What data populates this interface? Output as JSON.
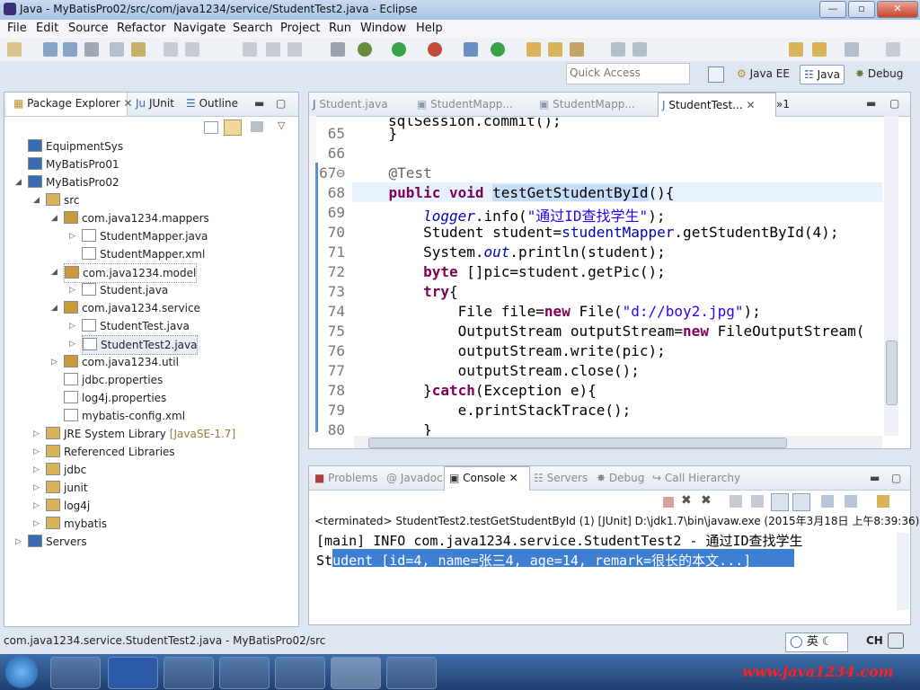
{
  "window": {
    "title": "Java - MyBatisPro02/src/com/java1234/service/StudentTest2.java - Eclipse",
    "min_label": "—",
    "max_label": "▫",
    "close_label": "✕"
  },
  "menu": [
    "File",
    "Edit",
    "Source",
    "Refactor",
    "Navigate",
    "Search",
    "Project",
    "Run",
    "Window",
    "Help"
  ],
  "quick_access": {
    "placeholder": "Quick Access"
  },
  "perspectives": [
    "Java EE",
    "Java",
    "Debug"
  ],
  "package_explorer": {
    "tabs": [
      "Package Explorer",
      "JUnit",
      "Outline"
    ],
    "tree": [
      {
        "label": "EquipmentSys",
        "level": 0,
        "arrow": ""
      },
      {
        "label": "MyBatisPro01",
        "level": 0,
        "arrow": ""
      },
      {
        "label": "MyBatisPro02",
        "level": 0,
        "arrow": "◢"
      },
      {
        "label": "src",
        "level": 1,
        "arrow": "◢"
      },
      {
        "label": "com.java1234.mappers",
        "level": 2,
        "arrow": "◢"
      },
      {
        "label": "StudentMapper.java",
        "level": 3,
        "arrow": "▷"
      },
      {
        "label": "StudentMapper.xml",
        "level": 3,
        "arrow": ""
      },
      {
        "label": "com.java1234.model",
        "level": 2,
        "arrow": "◢"
      },
      {
        "label": "Student.java",
        "level": 3,
        "arrow": "▷"
      },
      {
        "label": "com.java1234.service",
        "level": 2,
        "arrow": "◢"
      },
      {
        "label": "StudentTest.java",
        "level": 3,
        "arrow": "▷"
      },
      {
        "label": "StudentTest2.java",
        "level": 3,
        "arrow": "▷"
      },
      {
        "label": "com.java1234.util",
        "level": 2,
        "arrow": "▷"
      },
      {
        "label": "jdbc.properties",
        "level": 2,
        "arrow": ""
      },
      {
        "label": "log4j.properties",
        "level": 2,
        "arrow": ""
      },
      {
        "label": "mybatis-config.xml",
        "level": 2,
        "arrow": ""
      },
      {
        "label": "JRE System Library",
        "suffix": "[JavaSE-1.7]",
        "level": 1,
        "arrow": "▷"
      },
      {
        "label": "Referenced Libraries",
        "level": 1,
        "arrow": "▷"
      },
      {
        "label": "jdbc",
        "level": 1,
        "arrow": "▷"
      },
      {
        "label": "junit",
        "level": 1,
        "arrow": "▷"
      },
      {
        "label": "log4j",
        "level": 1,
        "arrow": "▷"
      },
      {
        "label": "mybatis",
        "level": 1,
        "arrow": "▷"
      },
      {
        "label": "Servers",
        "level": 0,
        "arrow": "▷"
      }
    ]
  },
  "editor": {
    "tabs": [
      "Student.java",
      "StudentMapp...",
      "StudentMapp...",
      "StudentTest..."
    ],
    "overflow_label": "»1",
    "lines": [
      {
        "num": "65",
        "code": "    }"
      },
      {
        "num": "66",
        "code": ""
      },
      {
        "num": "67⊖",
        "code": "    @Test"
      },
      {
        "num": "68",
        "code": "    public void testGetStudentById(){"
      },
      {
        "num": "69",
        "code": "        logger.info(\"通过ID查找学生\");"
      },
      {
        "num": "70",
        "code": "        Student student=studentMapper.getStudentById(4);"
      },
      {
        "num": "71",
        "code": "        System.out.println(student);"
      },
      {
        "num": "72",
        "code": "        byte []pic=student.getPic();"
      },
      {
        "num": "73",
        "code": "        try{"
      },
      {
        "num": "74",
        "code": "            File file=new File(\"d://boy2.jpg\");"
      },
      {
        "num": "75",
        "code": "            OutputStream outputStream=new FileOutputStream("
      },
      {
        "num": "76",
        "code": "            outputStream.write(pic);"
      },
      {
        "num": "77",
        "code": "            outputStream.close();"
      },
      {
        "num": "78",
        "code": "        }catch(Exception e){"
      },
      {
        "num": "79",
        "code": "            e.printStackTrace();"
      },
      {
        "num": "80",
        "code": "        }"
      }
    ]
  },
  "console": {
    "tabs": [
      "Problems",
      "Javadoc",
      "Console",
      "Servers",
      "Debug",
      "Call Hierarchy"
    ],
    "status_line": "<terminated> StudentTest2.testGetStudentById (1) [JUnit] D:\\jdk1.7\\bin\\javaw.exe (2015年3月18日 上午8:39:36)",
    "output": [
      "[main] INFO com.java1234.service.StudentTest2 - 通过ID查找学生",
      "Student [id=4, name=张三4, age=14, remark=很长的本文...]"
    ]
  },
  "statusbar": {
    "text": "com.java1234.service.StudentTest2.java - MyBatisPro02/src"
  },
  "taskbar": {
    "ime_label": "英",
    "lang": "CH",
    "watermark": "www.java1234.com"
  }
}
